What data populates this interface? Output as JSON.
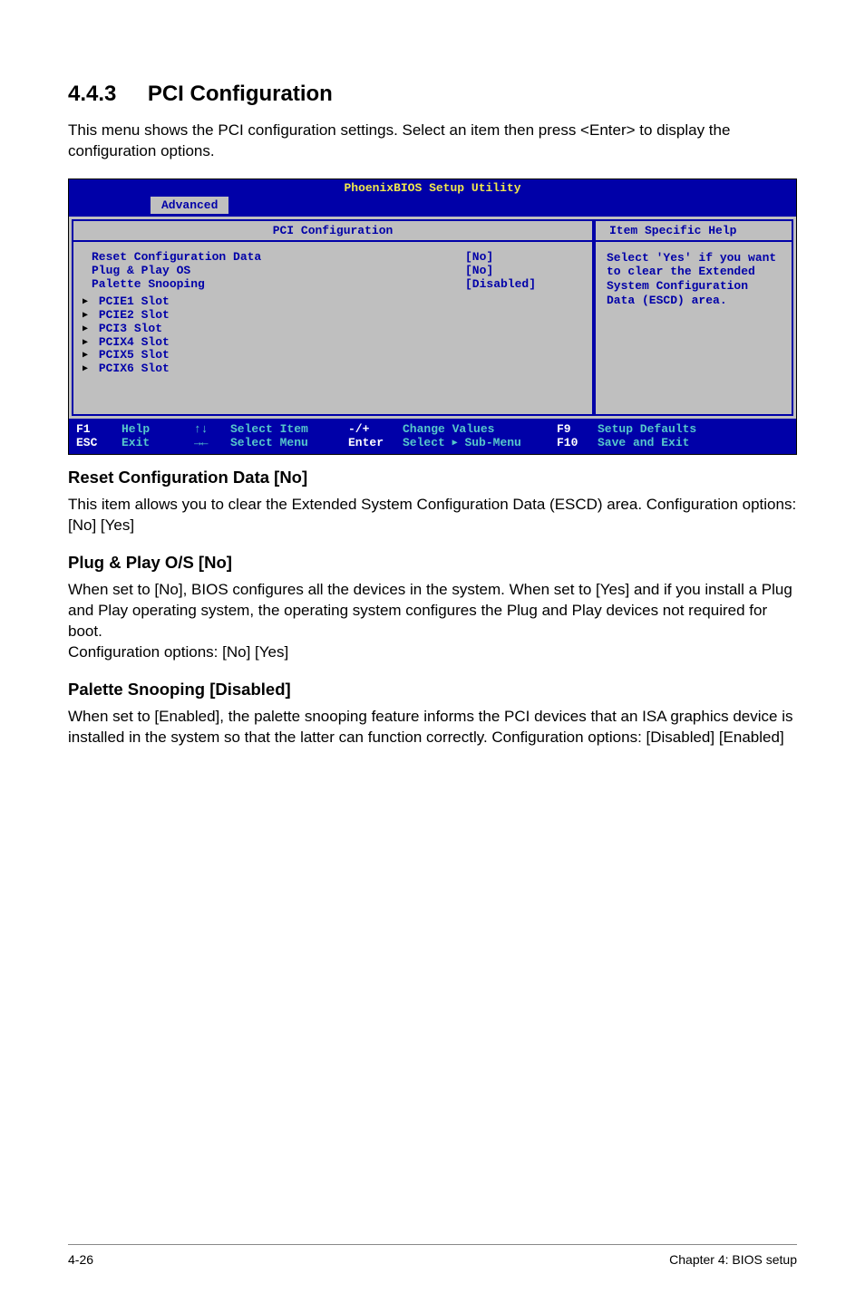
{
  "section": {
    "number": "4.4.3",
    "title": "PCI Configuration"
  },
  "intro": "This menu shows the PCI configuration settings. Select an item then press <Enter> to display the configuration options.",
  "bios": {
    "title": "PhoenixBIOS Setup Utility",
    "tab": "Advanced",
    "left_header": "PCI Configuration",
    "right_header": "Item Specific Help",
    "items": [
      {
        "label": "Reset Configuration Data",
        "value": "[No]",
        "submenu": false
      },
      {
        "label": "Plug & Play OS",
        "value": "[No]",
        "submenu": false
      },
      {
        "label": "Palette Snooping",
        "value": "[Disabled]",
        "submenu": false
      },
      {
        "label": "PCIE1 Slot",
        "value": "",
        "submenu": true
      },
      {
        "label": "PCIE2 Slot",
        "value": "",
        "submenu": true
      },
      {
        "label": "PCI3 Slot",
        "value": "",
        "submenu": true
      },
      {
        "label": "PCIX4 Slot",
        "value": "",
        "submenu": true
      },
      {
        "label": "PCIX5 Slot",
        "value": "",
        "submenu": true
      },
      {
        "label": "PCIX6 Slot",
        "value": "",
        "submenu": true
      }
    ],
    "help": "Select 'Yes' if you want to clear the Extended System Configuration Data (ESCD) area.",
    "footer": {
      "f1": "F1",
      "help": "Help",
      "updown": "↑↓",
      "select_item": "Select Item",
      "minusplus": "-/+",
      "change_values": "Change Values",
      "f9": "F9",
      "setup_defaults": "Setup Defaults",
      "esc": "ESC",
      "exit": "Exit",
      "leftright": "→←",
      "select_menu": "Select Menu",
      "enter": "Enter",
      "sub_menu_prefix": "Select ",
      "sub_menu_suffix": " Sub-Menu",
      "f10": "F10",
      "save_exit": "Save and Exit"
    }
  },
  "subsections": [
    {
      "title": "Reset Configuration Data [No]",
      "body": "This item allows you to clear the Extended System Configuration Data (ESCD) area. Configuration options: [No] [Yes]"
    },
    {
      "title": "Plug & Play O/S [No]",
      "body": "When set to [No], BIOS configures all the devices in the system. When set to [Yes] and if you install a Plug and Play operating system, the operating system configures the Plug and Play devices not required for boot.\nConfiguration options: [No] [Yes]"
    },
    {
      "title": "Palette Snooping [Disabled]",
      "body": "When set to [Enabled], the palette snooping feature informs the PCI devices that an ISA graphics device is installed in the system so that the latter can function correctly. Configuration options: [Disabled] [Enabled]"
    }
  ],
  "footer": {
    "page": "4-26",
    "chapter": "Chapter 4: BIOS setup"
  }
}
